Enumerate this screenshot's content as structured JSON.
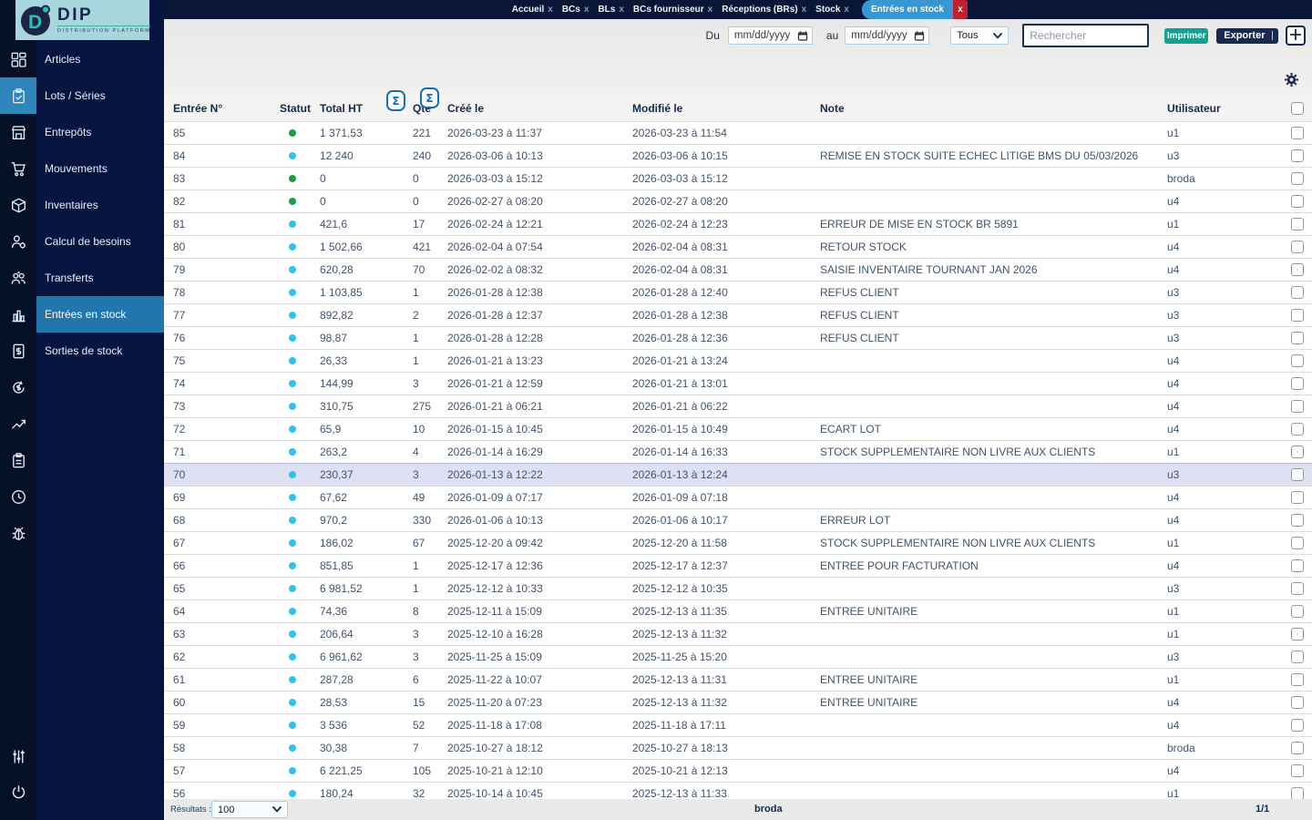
{
  "logo": {
    "title": "DIP",
    "subtitle": "DISTRIBUTION PLATFORM"
  },
  "topbar": {
    "close_label": "x",
    "tabs": [
      {
        "label": "Accueil",
        "active": false
      },
      {
        "label": "BCs",
        "active": false
      },
      {
        "label": "BLs",
        "active": false
      },
      {
        "label": "BCs fournisseur",
        "active": false
      },
      {
        "label": "Réceptions (BRs)",
        "active": false
      },
      {
        "label": "Stock",
        "active": false
      },
      {
        "label": "Entrées en stock",
        "active": true
      }
    ]
  },
  "sidebar": {
    "items": [
      {
        "label": "Articles",
        "icon": "dashboard-grid"
      },
      {
        "label": "Lots / Séries",
        "icon": "clipboard-check",
        "icon_active": true
      },
      {
        "label": "Entrepôts",
        "icon": "warehouse"
      },
      {
        "label": "Mouvements",
        "icon": "cart"
      },
      {
        "label": "Inventaires",
        "icon": "package"
      },
      {
        "label": "Calcul de besoins",
        "icon": "user-gear"
      },
      {
        "label": "Transferts",
        "icon": "people-group"
      },
      {
        "label": "Entrées en stock",
        "icon": "bar-chart",
        "active": true
      },
      {
        "label": "Sorties de stock",
        "icon": "invoice-dollar"
      }
    ],
    "extra_icons": [
      "money-cycle",
      "trend-line",
      "report-clipboard",
      "clock",
      "bug"
    ],
    "bottom_icons": [
      "sliders",
      "power"
    ]
  },
  "filters": {
    "from_label": "Du",
    "to_label": "au",
    "date_placeholder": "mm/dd/yyyy",
    "status_select": "Tous",
    "search_placeholder": "Rechercher",
    "print_label": "Imprimer",
    "export_label": "Exporter",
    "add_label": "+"
  },
  "table": {
    "sum_label": "Σ",
    "columns": [
      "Entrée N°",
      "Statut",
      "Total HT",
      "Qté",
      "Créé le",
      "Modifié le",
      "Note",
      "Utilisateur"
    ],
    "rows": [
      {
        "id": "85",
        "status": "green",
        "total": "1 371,53",
        "qty": "221",
        "created": "2026-03-23 à 11:37",
        "modified": "2026-03-23 à 11:54",
        "note": "",
        "user": "u1"
      },
      {
        "id": "84",
        "status": "blue",
        "total": "12 240",
        "qty": "240",
        "created": "2026-03-06 à 10:13",
        "modified": "2026-03-06 à 10:15",
        "note": "REMISE EN STOCK SUITE ECHEC LITIGE BMS DU 05/03/2026",
        "user": "u3"
      },
      {
        "id": "83",
        "status": "green",
        "total": "0",
        "qty": "0",
        "created": "2026-03-03 à 15:12",
        "modified": "2026-03-03 à 15:12",
        "note": "",
        "user": "broda"
      },
      {
        "id": "82",
        "status": "green",
        "total": "0",
        "qty": "0",
        "created": "2026-02-27 à 08:20",
        "modified": "2026-02-27 à 08:20",
        "note": "",
        "user": "u4"
      },
      {
        "id": "81",
        "status": "blue",
        "total": "421,6",
        "qty": "17",
        "created": "2026-02-24 à 12:21",
        "modified": "2026-02-24 à 12:23",
        "note": "ERREUR DE MISE EN STOCK BR 5891",
        "user": "u1"
      },
      {
        "id": "80",
        "status": "blue",
        "total": "1 502,66",
        "qty": "421",
        "created": "2026-02-04 à 07:54",
        "modified": "2026-02-04 à 08:31",
        "note": "RETOUR STOCK",
        "user": "u4"
      },
      {
        "id": "79",
        "status": "blue",
        "total": "620,28",
        "qty": "70",
        "created": "2026-02-02 à 08:32",
        "modified": "2026-02-04 à 08:31",
        "note": "SAISIE INVENTAIRE TOURNANT JAN 2026",
        "user": "u4"
      },
      {
        "id": "78",
        "status": "blue",
        "total": "1 103,85",
        "qty": "1",
        "created": "2026-01-28 à 12:38",
        "modified": "2026-01-28 à 12:40",
        "note": "REFUS CLIENT",
        "user": "u3"
      },
      {
        "id": "77",
        "status": "blue",
        "total": "892,82",
        "qty": "2",
        "created": "2026-01-28 à 12:37",
        "modified": "2026-01-28 à 12:38",
        "note": "REFUS CLIENT",
        "user": "u3"
      },
      {
        "id": "76",
        "status": "blue",
        "total": "98,87",
        "qty": "1",
        "created": "2026-01-28 à 12:28",
        "modified": "2026-01-28 à 12:36",
        "note": "REFUS CLIENT",
        "user": "u3"
      },
      {
        "id": "75",
        "status": "blue",
        "total": "26,33",
        "qty": "1",
        "created": "2026-01-21 à 13:23",
        "modified": "2026-01-21 à 13:24",
        "note": "",
        "user": "u4"
      },
      {
        "id": "74",
        "status": "blue",
        "total": "144,99",
        "qty": "3",
        "created": "2026-01-21 à 12:59",
        "modified": "2026-01-21 à 13:01",
        "note": "",
        "user": "u4"
      },
      {
        "id": "73",
        "status": "blue",
        "total": "310,75",
        "qty": "275",
        "created": "2026-01-21 à 06:21",
        "modified": "2026-01-21 à 06:22",
        "note": "",
        "user": "u4"
      },
      {
        "id": "72",
        "status": "blue",
        "total": "65,9",
        "qty": "10",
        "created": "2026-01-15 à 10:45",
        "modified": "2026-01-15 à 10:49",
        "note": "ECART LOT",
        "user": "u4"
      },
      {
        "id": "71",
        "status": "blue",
        "total": "263,2",
        "qty": "4",
        "created": "2026-01-14 à 16:29",
        "modified": "2026-01-14 à 16:33",
        "note": "STOCK SUPPLEMENTAIRE NON LIVRE AUX CLIENTS",
        "user": "u1"
      },
      {
        "id": "70",
        "status": "blue",
        "total": "230,37",
        "qty": "3",
        "created": "2026-01-13 à 12:22",
        "modified": "2026-01-13 à 12:24",
        "note": "",
        "user": "u3",
        "highlighted": true
      },
      {
        "id": "69",
        "status": "blue",
        "total": "67,62",
        "qty": "49",
        "created": "2026-01-09 à 07:17",
        "modified": "2026-01-09 à 07:18",
        "note": "",
        "user": "u4"
      },
      {
        "id": "68",
        "status": "blue",
        "total": "970,2",
        "qty": "330",
        "created": "2026-01-06 à 10:13",
        "modified": "2026-01-06 à 10:17",
        "note": "ERREUR LOT",
        "user": "u4"
      },
      {
        "id": "67",
        "status": "blue",
        "total": "186,02",
        "qty": "67",
        "created": "2025-12-20 à 09:42",
        "modified": "2025-12-20 à 11:58",
        "note": "STOCK SUPPLEMENTAIRE NON LIVRE AUX CLIENTS",
        "user": "u1"
      },
      {
        "id": "66",
        "status": "blue",
        "total": "851,85",
        "qty": "1",
        "created": "2025-12-17 à 12:36",
        "modified": "2025-12-17 à 12:37",
        "note": "ENTREE POUR FACTURATION",
        "user": "u4"
      },
      {
        "id": "65",
        "status": "blue",
        "total": "6 981,52",
        "qty": "1",
        "created": "2025-12-12 à 10:33",
        "modified": "2025-12-12 à 10:35",
        "note": "",
        "user": "u3"
      },
      {
        "id": "64",
        "status": "blue",
        "total": "74,36",
        "qty": "8",
        "created": "2025-12-11 à 15:09",
        "modified": "2025-12-13 à 11:35",
        "note": "ENTREE UNITAIRE",
        "user": "u1"
      },
      {
        "id": "63",
        "status": "blue",
        "total": "206,64",
        "qty": "3",
        "created": "2025-12-10 à 16:28",
        "modified": "2025-12-13 à 11:32",
        "note": "",
        "user": "u1"
      },
      {
        "id": "62",
        "status": "blue",
        "total": "6 961,62",
        "qty": "3",
        "created": "2025-11-25 à 15:09",
        "modified": "2025-11-25 à 15:20",
        "note": "",
        "user": "u3"
      },
      {
        "id": "61",
        "status": "blue",
        "total": "287,28",
        "qty": "6",
        "created": "2025-11-22 à 10:07",
        "modified": "2025-12-13 à 11:31",
        "note": "ENTREE UNITAIRE",
        "user": "u1"
      },
      {
        "id": "60",
        "status": "blue",
        "total": "28,53",
        "qty": "15",
        "created": "2025-11-20 à 07:23",
        "modified": "2025-12-13 à 11:32",
        "note": "ENTREE UNITAIRE",
        "user": "u4"
      },
      {
        "id": "59",
        "status": "blue",
        "total": "3 536",
        "qty": "52",
        "created": "2025-11-18 à 17:08",
        "modified": "2025-11-18 à 17:11",
        "note": "",
        "user": "u4"
      },
      {
        "id": "58",
        "status": "blue",
        "total": "30,38",
        "qty": "7",
        "created": "2025-10-27 à 18:12",
        "modified": "2025-10-27 à 18:13",
        "note": "",
        "user": "broda"
      },
      {
        "id": "57",
        "status": "blue",
        "total": "6 221,25",
        "qty": "105",
        "created": "2025-10-21 à 12:10",
        "modified": "2025-10-21 à 12:13",
        "note": "",
        "user": "u4"
      },
      {
        "id": "56",
        "status": "blue",
        "total": "180,24",
        "qty": "32",
        "created": "2025-10-14 à 10:45",
        "modified": "2025-12-13 à 11:33",
        "note": "",
        "user": "u1"
      }
    ]
  },
  "footer": {
    "results_label": "Résultats :",
    "page_size": "100",
    "user": "broda",
    "page": "1/1"
  },
  "colors": {
    "topbar": "#0a1636",
    "rail": "#050f27",
    "subnav": "#061540",
    "active_tab": "#3697d3",
    "active_tab_close": "#c0202f",
    "sidebar_active": "#2176ae",
    "rail_active": "#2e86ba",
    "logo_bg": "#a7d6dc",
    "logo_teal": "#35b5aa",
    "print_button": "#12a18e",
    "export_button": "#152a4e",
    "status_green": "#1d9e3d",
    "status_blue": "#2fc2ef",
    "row_highlight": "#dee1f3",
    "sum_button_border": "#0f6fc0"
  }
}
